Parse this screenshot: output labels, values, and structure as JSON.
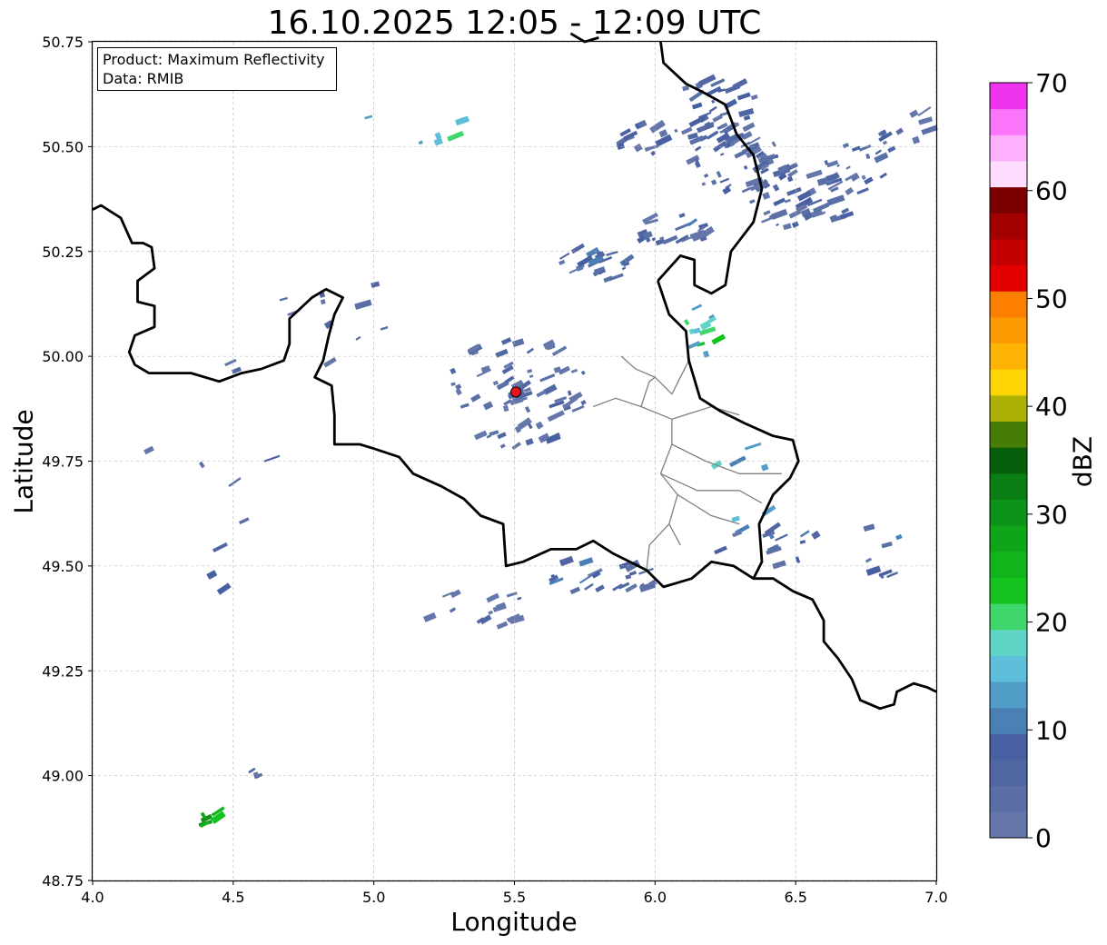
{
  "chart_data": {
    "type": "heatmap",
    "title": "16.10.2025 12:05 - 12:09 UTC",
    "xlabel": "Longitude",
    "ylabel": "Latitude",
    "xlim": [
      4.0,
      7.0
    ],
    "ylim": [
      48.75,
      50.75
    ],
    "x_ticks": [
      "4.0",
      "4.5",
      "5.0",
      "5.5",
      "6.0",
      "6.5",
      "7.0"
    ],
    "y_ticks": [
      "48.75",
      "49.00",
      "49.25",
      "49.50",
      "49.75",
      "50.00",
      "50.25",
      "50.50",
      "50.75"
    ],
    "grid": true,
    "info_box": {
      "product": "Product: Maximum Reflectivity",
      "data": "Data: RMIB",
      "placement": "top-left"
    },
    "radar_site": {
      "lon": 5.505,
      "lat": 49.915,
      "color": "#e8141c"
    },
    "colorbar": {
      "label": "dBZ",
      "range": [
        0,
        70
      ],
      "step": 2.5,
      "ticks": [
        "0",
        "10",
        "20",
        "30",
        "40",
        "50",
        "60",
        "70"
      ],
      "colors": [
        "#6577aa",
        "#5a6fa6",
        "#5167a3",
        "#4860a2",
        "#4a80b6",
        "#519fc8",
        "#5fbed9",
        "#60d5c7",
        "#3fd76b",
        "#14c31e",
        "#11b41b",
        "#0fa518",
        "#0c9216",
        "#0a7e12",
        "#075f0c",
        "#477c07",
        "#adb103",
        "#fdd503",
        "#fcb303",
        "#fc9a00",
        "#fc7f00",
        "#e40000",
        "#c40000",
        "#a30000",
        "#7b0000",
        "#fddcfd",
        "#fdb1fd",
        "#fb75fb",
        "#ee34ee"
      ]
    },
    "echoes": [
      {
        "lon": 6.2,
        "lat": 50.58,
        "rx": 0.17,
        "ry": 0.08,
        "dbz": 5,
        "n": 40
      },
      {
        "lon": 6.3,
        "lat": 50.46,
        "rx": 0.2,
        "ry": 0.07,
        "dbz": 5,
        "n": 45
      },
      {
        "lon": 6.5,
        "lat": 50.37,
        "rx": 0.2,
        "ry": 0.07,
        "dbz": 4,
        "n": 40
      },
      {
        "lon": 6.7,
        "lat": 50.45,
        "rx": 0.12,
        "ry": 0.06,
        "dbz": 4,
        "n": 18
      },
      {
        "lon": 6.85,
        "lat": 50.55,
        "rx": 0.1,
        "ry": 0.06,
        "dbz": 3,
        "n": 12
      },
      {
        "lon": 6.05,
        "lat": 50.3,
        "rx": 0.14,
        "ry": 0.04,
        "dbz": 6,
        "n": 22
      },
      {
        "lon": 5.95,
        "lat": 50.52,
        "rx": 0.1,
        "ry": 0.04,
        "dbz": 5,
        "n": 14
      },
      {
        "lon": 5.75,
        "lat": 50.22,
        "rx": 0.16,
        "ry": 0.04,
        "dbz": 6,
        "n": 24
      },
      {
        "lon": 6.15,
        "lat": 50.05,
        "rx": 0.06,
        "ry": 0.07,
        "dbz": 18,
        "n": 12
      },
      {
        "lon": 5.5,
        "lat": 49.92,
        "rx": 0.25,
        "ry": 0.14,
        "dbz": 3,
        "n": 70
      },
      {
        "lon": 5.8,
        "lat": 49.48,
        "rx": 0.2,
        "ry": 0.05,
        "dbz": 6,
        "n": 22
      },
      {
        "lon": 5.35,
        "lat": 49.4,
        "rx": 0.2,
        "ry": 0.05,
        "dbz": 3,
        "n": 16
      },
      {
        "lon": 6.4,
        "lat": 49.55,
        "rx": 0.2,
        "ry": 0.05,
        "dbz": 7,
        "n": 14
      },
      {
        "lon": 6.8,
        "lat": 49.55,
        "rx": 0.08,
        "ry": 0.08,
        "dbz": 6,
        "n": 8
      },
      {
        "lon": 4.85,
        "lat": 50.1,
        "rx": 0.2,
        "ry": 0.12,
        "dbz": 3,
        "n": 10
      },
      {
        "lon": 4.4,
        "lat": 49.7,
        "rx": 0.25,
        "ry": 0.3,
        "dbz": 6,
        "n": 10
      },
      {
        "lon": 5.2,
        "lat": 50.55,
        "rx": 0.4,
        "ry": 0.1,
        "dbz": 16,
        "n": 6
      },
      {
        "lon": 4.39,
        "lat": 48.9,
        "rx": 0.04,
        "ry": 0.02,
        "dbz": 26,
        "n": 6
      },
      {
        "lon": 4.55,
        "lat": 49.0,
        "rx": 0.03,
        "ry": 0.01,
        "dbz": 4,
        "n": 3
      },
      {
        "lon": 6.3,
        "lat": 49.7,
        "rx": 0.12,
        "ry": 0.1,
        "dbz": 14,
        "n": 6
      }
    ],
    "borders": {
      "national": [
        [
          [
            4.0,
            50.35
          ],
          [
            4.03,
            50.36
          ],
          [
            4.1,
            50.33
          ],
          [
            4.14,
            50.27
          ],
          [
            4.18,
            50.27
          ],
          [
            4.21,
            50.26
          ],
          [
            4.22,
            50.21
          ],
          [
            4.16,
            50.18
          ],
          [
            4.16,
            50.13
          ],
          [
            4.22,
            50.12
          ],
          [
            4.22,
            50.07
          ],
          [
            4.15,
            50.05
          ],
          [
            4.13,
            50.01
          ],
          [
            4.15,
            49.98
          ],
          [
            4.2,
            49.96
          ],
          [
            4.35,
            49.96
          ],
          [
            4.45,
            49.94
          ],
          [
            4.53,
            49.96
          ],
          [
            4.6,
            49.97
          ],
          [
            4.68,
            49.99
          ],
          [
            4.7,
            50.03
          ],
          [
            4.7,
            50.09
          ],
          [
            4.78,
            50.14
          ],
          [
            4.83,
            50.16
          ],
          [
            4.89,
            50.14
          ],
          [
            4.86,
            50.1
          ],
          [
            4.84,
            50.05
          ],
          [
            4.82,
            49.99
          ],
          [
            4.79,
            49.95
          ],
          [
            4.85,
            49.93
          ],
          [
            4.86,
            49.86
          ],
          [
            4.86,
            49.79
          ],
          [
            4.9,
            49.79
          ],
          [
            4.95,
            49.79
          ],
          [
            5.0,
            49.78
          ],
          [
            5.09,
            49.76
          ],
          [
            5.14,
            49.72
          ],
          [
            5.24,
            49.69
          ],
          [
            5.32,
            49.66
          ],
          [
            5.38,
            49.62
          ],
          [
            5.46,
            49.6
          ],
          [
            5.47,
            49.5
          ],
          [
            5.53,
            49.51
          ],
          [
            5.63,
            49.54
          ],
          [
            5.72,
            49.54
          ],
          [
            5.78,
            49.56
          ],
          [
            5.85,
            49.53
          ],
          [
            5.91,
            49.51
          ],
          [
            5.97,
            49.49
          ],
          [
            6.03,
            49.45
          ],
          [
            6.08,
            49.46
          ],
          [
            6.13,
            49.47
          ],
          [
            6.2,
            49.51
          ],
          [
            6.28,
            49.5
          ],
          [
            6.35,
            49.47
          ],
          [
            6.42,
            49.47
          ],
          [
            6.49,
            49.44
          ],
          [
            6.56,
            49.42
          ],
          [
            6.6,
            49.37
          ],
          [
            6.6,
            49.32
          ],
          [
            6.65,
            49.28
          ],
          [
            6.7,
            49.23
          ],
          [
            6.73,
            49.18
          ],
          [
            6.8,
            49.16
          ],
          [
            6.85,
            49.17
          ],
          [
            6.86,
            49.2
          ],
          [
            6.92,
            49.22
          ],
          [
            6.97,
            49.21
          ],
          [
            7.0,
            49.2
          ]
        ],
        [
          [
            6.01,
            50.18
          ],
          [
            6.05,
            50.1
          ],
          [
            6.11,
            50.06
          ],
          [
            6.12,
            49.99
          ],
          [
            6.16,
            49.9
          ],
          [
            6.23,
            49.87
          ],
          [
            6.32,
            49.84
          ],
          [
            6.42,
            49.81
          ],
          [
            6.49,
            49.8
          ],
          [
            6.51,
            49.75
          ],
          [
            6.48,
            49.71
          ],
          [
            6.42,
            49.67
          ],
          [
            6.37,
            49.6
          ],
          [
            6.38,
            49.51
          ],
          [
            6.35,
            49.47
          ]
        ],
        [
          [
            6.01,
            50.18
          ],
          [
            6.05,
            50.21
          ],
          [
            6.09,
            50.24
          ],
          [
            6.14,
            50.23
          ],
          [
            6.14,
            50.17
          ],
          [
            6.2,
            50.15
          ],
          [
            6.25,
            50.17
          ],
          [
            6.27,
            50.25
          ],
          [
            6.35,
            50.32
          ],
          [
            6.38,
            50.4
          ],
          [
            6.35,
            50.48
          ],
          [
            6.29,
            50.53
          ],
          [
            6.25,
            50.6
          ],
          [
            6.17,
            50.63
          ],
          [
            6.11,
            50.65
          ],
          [
            6.03,
            50.7
          ],
          [
            6.02,
            50.75
          ]
        ],
        [
          [
            5.7,
            50.77
          ],
          [
            5.75,
            50.75
          ],
          [
            5.8,
            50.76
          ]
        ]
      ],
      "regional": [
        [
          [
            6.06,
            49.85
          ],
          [
            6.06,
            49.79
          ],
          [
            6.02,
            49.72
          ],
          [
            6.08,
            49.67
          ],
          [
            6.05,
            49.6
          ],
          [
            6.09,
            49.55
          ]
        ],
        [
          [
            6.06,
            49.85
          ],
          [
            6.2,
            49.88
          ],
          [
            6.3,
            49.86
          ]
        ],
        [
          [
            6.06,
            49.79
          ],
          [
            6.18,
            49.75
          ],
          [
            6.3,
            49.72
          ],
          [
            6.45,
            49.72
          ]
        ],
        [
          [
            6.02,
            49.72
          ],
          [
            6.15,
            49.68
          ],
          [
            6.3,
            49.68
          ],
          [
            6.38,
            49.65
          ]
        ],
        [
          [
            6.08,
            49.67
          ],
          [
            6.2,
            49.62
          ],
          [
            6.3,
            49.6
          ]
        ],
        [
          [
            5.97,
            49.49
          ],
          [
            5.98,
            49.55
          ],
          [
            6.05,
            49.6
          ]
        ],
        [
          [
            5.78,
            49.88
          ],
          [
            5.86,
            49.9
          ],
          [
            5.95,
            49.88
          ],
          [
            6.06,
            49.85
          ]
        ],
        [
          [
            5.88,
            50.0
          ],
          [
            5.93,
            49.97
          ],
          [
            6.0,
            49.95
          ],
          [
            6.06,
            49.91
          ],
          [
            6.12,
            49.99
          ]
        ],
        [
          [
            5.95,
            49.88
          ],
          [
            5.98,
            49.94
          ],
          [
            6.0,
            49.95
          ]
        ]
      ]
    }
  }
}
